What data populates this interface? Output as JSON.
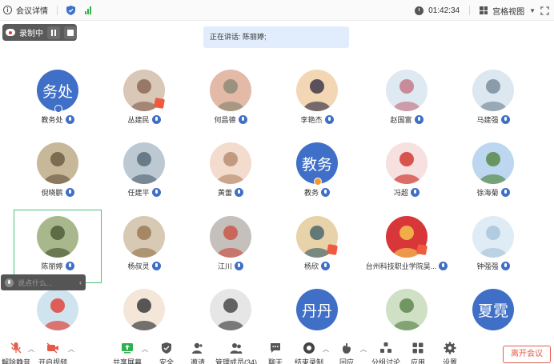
{
  "topbar": {
    "meeting_details": "会议详情",
    "timer": "01:42:34",
    "view_label": "宫格视图",
    "colors": {
      "signal": "#2fb24c",
      "shield": "#3f6fc7"
    }
  },
  "recording": {
    "label": "录制中"
  },
  "speaking": {
    "text": "正在讲话: 陈丽婷;"
  },
  "participants": [
    {
      "name": "教务处",
      "avatar_text": "务处",
      "row": 0,
      "col": 0
    },
    {
      "name": "丛建民",
      "row": 0,
      "col": 1
    },
    {
      "name": "何昌德",
      "row": 0,
      "col": 2
    },
    {
      "name": "李艳杰",
      "row": 0,
      "col": 3
    },
    {
      "name": "赵国富",
      "row": 0,
      "col": 4
    },
    {
      "name": "马建强",
      "row": 0,
      "col": 5
    },
    {
      "name": "倪晓鹏",
      "row": 1,
      "col": 0
    },
    {
      "name": "任建平",
      "row": 1,
      "col": 1
    },
    {
      "name": "黄蕾",
      "row": 1,
      "col": 2
    },
    {
      "name": "教务",
      "avatar_text": "教务",
      "row": 1,
      "col": 3
    },
    {
      "name": "冯超",
      "row": 1,
      "col": 4
    },
    {
      "name": "徐海菊",
      "row": 1,
      "col": 5
    },
    {
      "name": "陈丽婷",
      "row": 2,
      "col": 0
    },
    {
      "name": "杨叔灵",
      "row": 2,
      "col": 1
    },
    {
      "name": "江川",
      "row": 2,
      "col": 2
    },
    {
      "name": "杨欣",
      "row": 2,
      "col": 3
    },
    {
      "name": "台州科技职业学院吴...",
      "row": 2,
      "col": 4
    },
    {
      "name": "钟强强",
      "row": 2,
      "col": 5
    },
    {
      "name": "",
      "row": 3,
      "col": 0
    },
    {
      "name": "",
      "row": 3,
      "col": 1
    },
    {
      "name": "",
      "row": 3,
      "col": 2
    },
    {
      "name": "",
      "avatar_text": "丹丹",
      "row": 3,
      "col": 3
    },
    {
      "name": "",
      "row": 3,
      "col": 4
    },
    {
      "name": "",
      "avatar_text": "夏霓",
      "row": 3,
      "col": 5
    }
  ],
  "chat": {
    "placeholder": "说点什么..."
  },
  "toolbar": {
    "unmute": "解除静音",
    "start_video": "开启视频",
    "share_screen": "共享屏幕",
    "security": "安全",
    "invite": "邀请",
    "manage_members": "管理成员(34)",
    "chat": "聊天",
    "end_recording": "结束录制",
    "reactions": "回应",
    "breakout": "分组讨论",
    "apps": "应用",
    "settings": "设置",
    "leave": "离开会议",
    "colors": {
      "leave": "#e55b4b",
      "accent": "#3f6fc7",
      "mute": "#e55b4b"
    }
  }
}
